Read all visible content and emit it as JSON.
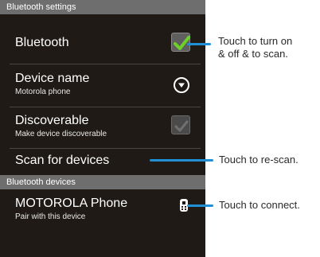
{
  "header": {
    "title": "Bluetooth settings"
  },
  "rows": {
    "bluetooth": {
      "title": "Bluetooth",
      "checked": true
    },
    "device_name": {
      "title": "Device name",
      "sub": "Motorola phone"
    },
    "discoverable": {
      "title": "Discoverable",
      "sub": "Make device discoverable",
      "checked": false
    },
    "scan": {
      "title": "Scan for devices"
    }
  },
  "devices_section": {
    "title": "Bluetooth devices",
    "items": [
      {
        "title": "MOTOROLA Phone",
        "sub": "Pair with this device"
      }
    ]
  },
  "callouts": {
    "toggle": [
      "Touch  to turn on",
      "& off & to scan."
    ],
    "rescan": "Touch to re-scan.",
    "connect": "Touch to connect."
  },
  "colors": {
    "accent_check": "#6dd12a",
    "callout_line": "#1f8fd6",
    "screen_bg": "#1f1a16",
    "header_bg": "#6e6e6e"
  }
}
